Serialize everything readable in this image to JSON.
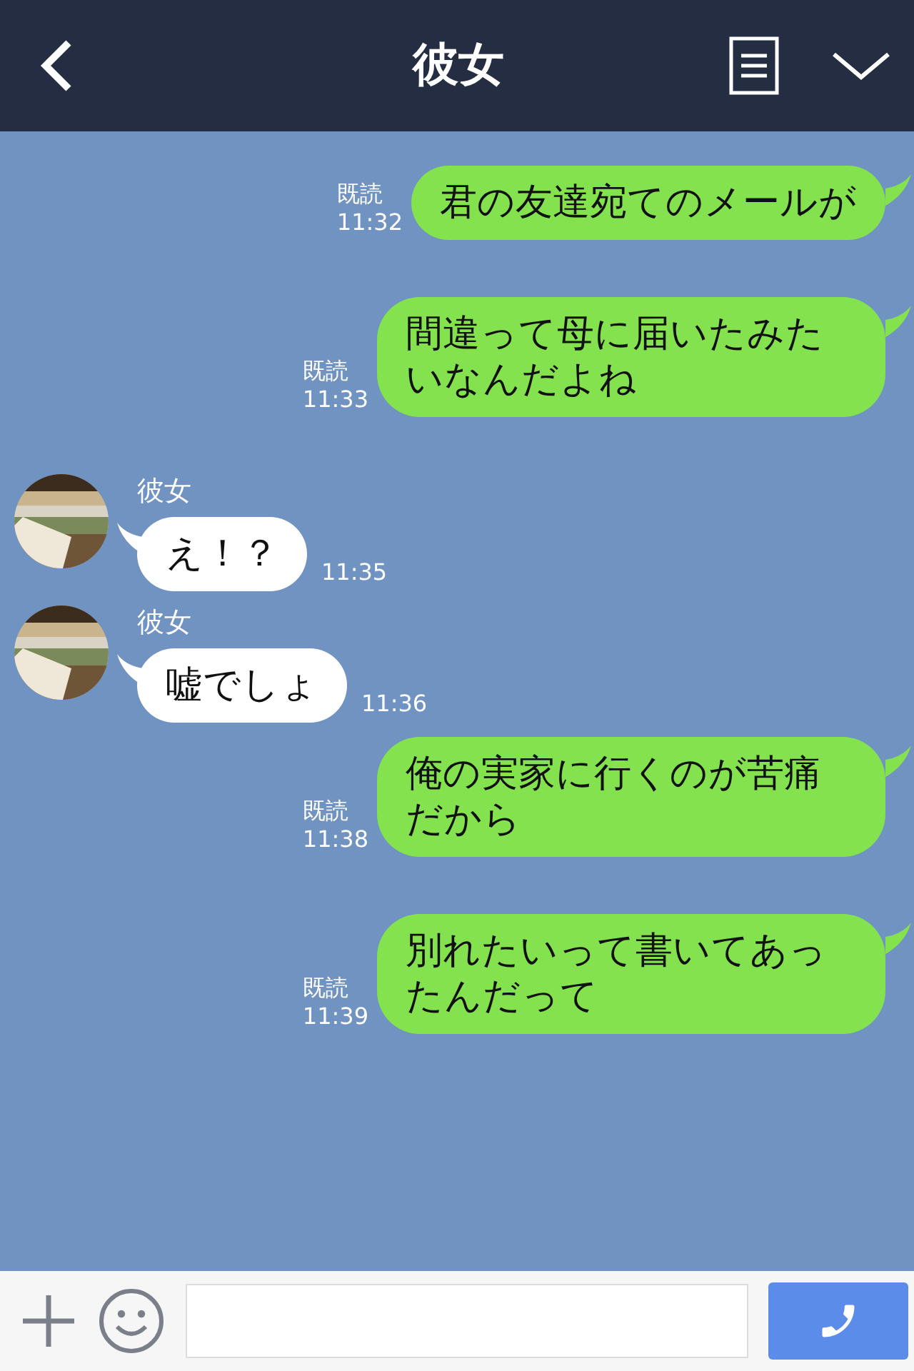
{
  "header": {
    "title": "彼女"
  },
  "messages": [
    {
      "kind": "sent",
      "text": "君の友達宛てのメールが",
      "read": "既読",
      "time": "11:32"
    },
    {
      "kind": "sent",
      "text": "間違って母に届いたみたいなんだよね",
      "read": "既読",
      "time": "11:33"
    },
    {
      "kind": "received",
      "name": "彼女",
      "text": "え！？",
      "time": "11:35"
    },
    {
      "kind": "received",
      "name": "彼女",
      "text": "嘘でしょ",
      "time": "11:36"
    },
    {
      "kind": "sent",
      "text": "俺の実家に行くのが苦痛だから",
      "read": "既読",
      "time": "11:38"
    },
    {
      "kind": "sent",
      "text": "別れたいって書いてあったんだって",
      "read": "既読",
      "time": "11:39"
    }
  ]
}
